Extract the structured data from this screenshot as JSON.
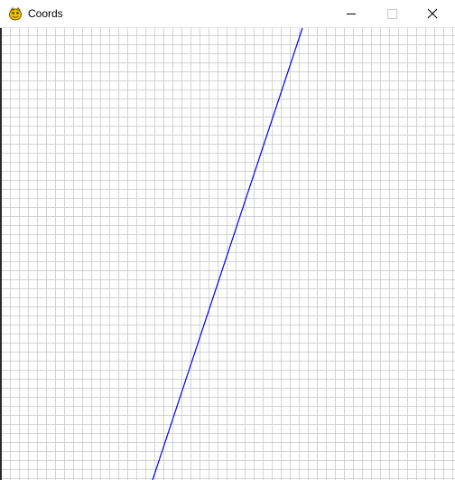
{
  "window": {
    "title": "Coords",
    "app_icon": "pygame-snake-icon",
    "controls": {
      "minimize_icon": "minimize-icon",
      "maximize_icon": "maximize-icon",
      "close_icon": "close-icon"
    }
  },
  "canvas": {
    "background_color": "#ffffff",
    "grid_color": "#d3d3d3",
    "line_color": "#0000ff",
    "grid": true
  }
}
